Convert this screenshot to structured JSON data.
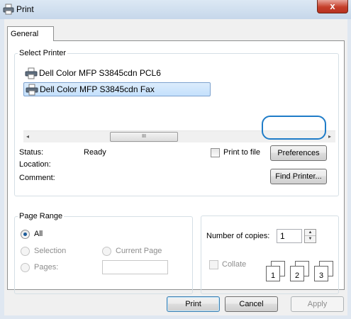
{
  "window": {
    "title": "Print",
    "close_label": "x"
  },
  "tabs": [
    {
      "label": "General"
    }
  ],
  "select_printer": {
    "label": "Select Printer",
    "printers": [
      {
        "name": "Dell Color MFP S3845cdn PCL6",
        "selected": false
      },
      {
        "name": "Dell Color MFP S3845cdn Fax",
        "selected": true
      }
    ],
    "scroll_thumb": "III",
    "status_label": "Status:",
    "status_value": "Ready",
    "location_label": "Location:",
    "comment_label": "Comment:",
    "print_to_file_label": "Print to file",
    "preferences_label": "Preferences",
    "find_printer_label": "Find Printer..."
  },
  "page_range": {
    "label": "Page Range",
    "options": [
      {
        "label": "All",
        "checked": true,
        "enabled": true
      },
      {
        "label": "Selection",
        "checked": false,
        "enabled": false
      },
      {
        "label": "Current Page",
        "checked": false,
        "enabled": false
      },
      {
        "label": "Pages:",
        "checked": false,
        "enabled": false
      }
    ]
  },
  "copies": {
    "label": "Number of copies:",
    "value": "1",
    "collate_label": "Collate",
    "collate_pages": [
      "1",
      "1",
      "2",
      "2",
      "3",
      "3"
    ]
  },
  "footer": {
    "print_label": "Print",
    "cancel_label": "Cancel",
    "apply_label": "Apply"
  },
  "colors": {
    "accent_ring": "#1f7cc8",
    "selection_bg": "#c4e0fc",
    "close_red": "#c53f2a"
  }
}
